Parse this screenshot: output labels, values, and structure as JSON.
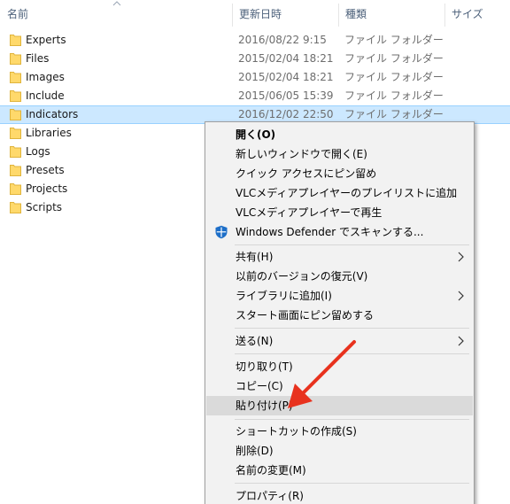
{
  "columns": {
    "name": "名前",
    "modified": "更新日時",
    "type": "種類",
    "size": "サイズ"
  },
  "files": [
    {
      "name": "Experts",
      "date": "2016/08/22 9:15",
      "type": "ファイル フォルダー"
    },
    {
      "name": "Files",
      "date": "2015/02/04 18:21",
      "type": "ファイル フォルダー"
    },
    {
      "name": "Images",
      "date": "2015/02/04 18:21",
      "type": "ファイル フォルダー"
    },
    {
      "name": "Include",
      "date": "2015/06/05 15:39",
      "type": "ファイル フォルダー"
    },
    {
      "name": "Indicators",
      "date": "2016/12/02 22:50",
      "type": "ファイル フォルダー"
    },
    {
      "name": "Libraries",
      "date": "",
      "type": ""
    },
    {
      "name": "Logs",
      "date": "",
      "type": ""
    },
    {
      "name": "Presets",
      "date": "",
      "type": ""
    },
    {
      "name": "Projects",
      "date": "",
      "type": ""
    },
    {
      "name": "Scripts",
      "date": "",
      "type": ""
    }
  ],
  "selected_row": "Indicators",
  "context_menu": {
    "open": "開く(O)",
    "open_new_window": "新しいウィンドウで開く(E)",
    "pin_quick_access": "クイック アクセスにピン留め",
    "vlc_add_playlist": "VLCメディアプレイヤーのプレイリストに追加",
    "vlc_play": "VLCメディアプレイヤーで再生",
    "defender_scan": "Windows Defender でスキャンする...",
    "share": "共有(H)",
    "restore_versions": "以前のバージョンの復元(V)",
    "add_to_library": "ライブラリに追加(I)",
    "pin_start": "スタート画面にピン留めする",
    "send_to": "送る(N)",
    "cut": "切り取り(T)",
    "copy": "コピー(C)",
    "paste": "貼り付け(P)",
    "create_shortcut": "ショートカットの作成(S)",
    "delete": "削除(D)",
    "rename": "名前の変更(M)",
    "properties": "プロパティ(R)"
  },
  "hovered_menu_item": "paste",
  "colors": {
    "selection": "#cce8ff",
    "menu_bg": "#f2f2f2",
    "menu_hover": "#dadada",
    "folder": "#ffd96b",
    "annotation_arrow": "#e8321e",
    "defender": "#1e6fc8"
  },
  "icons": {
    "folder": "folder-icon",
    "defender": "windows-defender-icon",
    "submenu": "chevron-right-icon",
    "sort": "sort-ascending-icon"
  }
}
